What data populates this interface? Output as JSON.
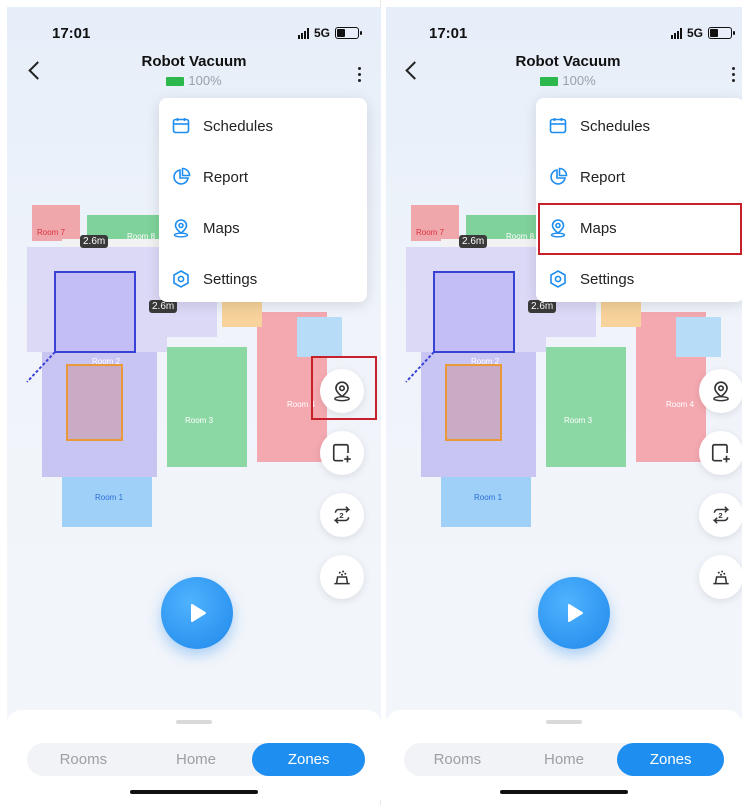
{
  "status": {
    "time": "17:01",
    "network": "5G"
  },
  "header": {
    "title": "Robot Vacuum",
    "battery": "100%"
  },
  "menu": {
    "items": [
      {
        "label": "Schedules",
        "icon": "calendar-icon"
      },
      {
        "label": "Report",
        "icon": "pie-chart-icon"
      },
      {
        "label": "Maps",
        "icon": "map-pin-icon"
      },
      {
        "label": "Settings",
        "icon": "hexagon-gear-icon"
      }
    ]
  },
  "map": {
    "rooms": [
      "Room 7",
      "Room 8",
      "Room 2",
      "Room 3",
      "Room 4",
      "Room 1"
    ],
    "dimensions": [
      "2.6m",
      "2.6m"
    ]
  },
  "side_buttons": [
    "map-pin-icon",
    "add-zone-icon",
    "repeat-2-icon",
    "mop-icon"
  ],
  "tabs": {
    "items": [
      "Rooms",
      "Home",
      "Zones"
    ],
    "selected": "Zones"
  },
  "colors": {
    "accent": "#1e8ef0",
    "highlight": "#c8202a",
    "battery": "#2db84d"
  }
}
